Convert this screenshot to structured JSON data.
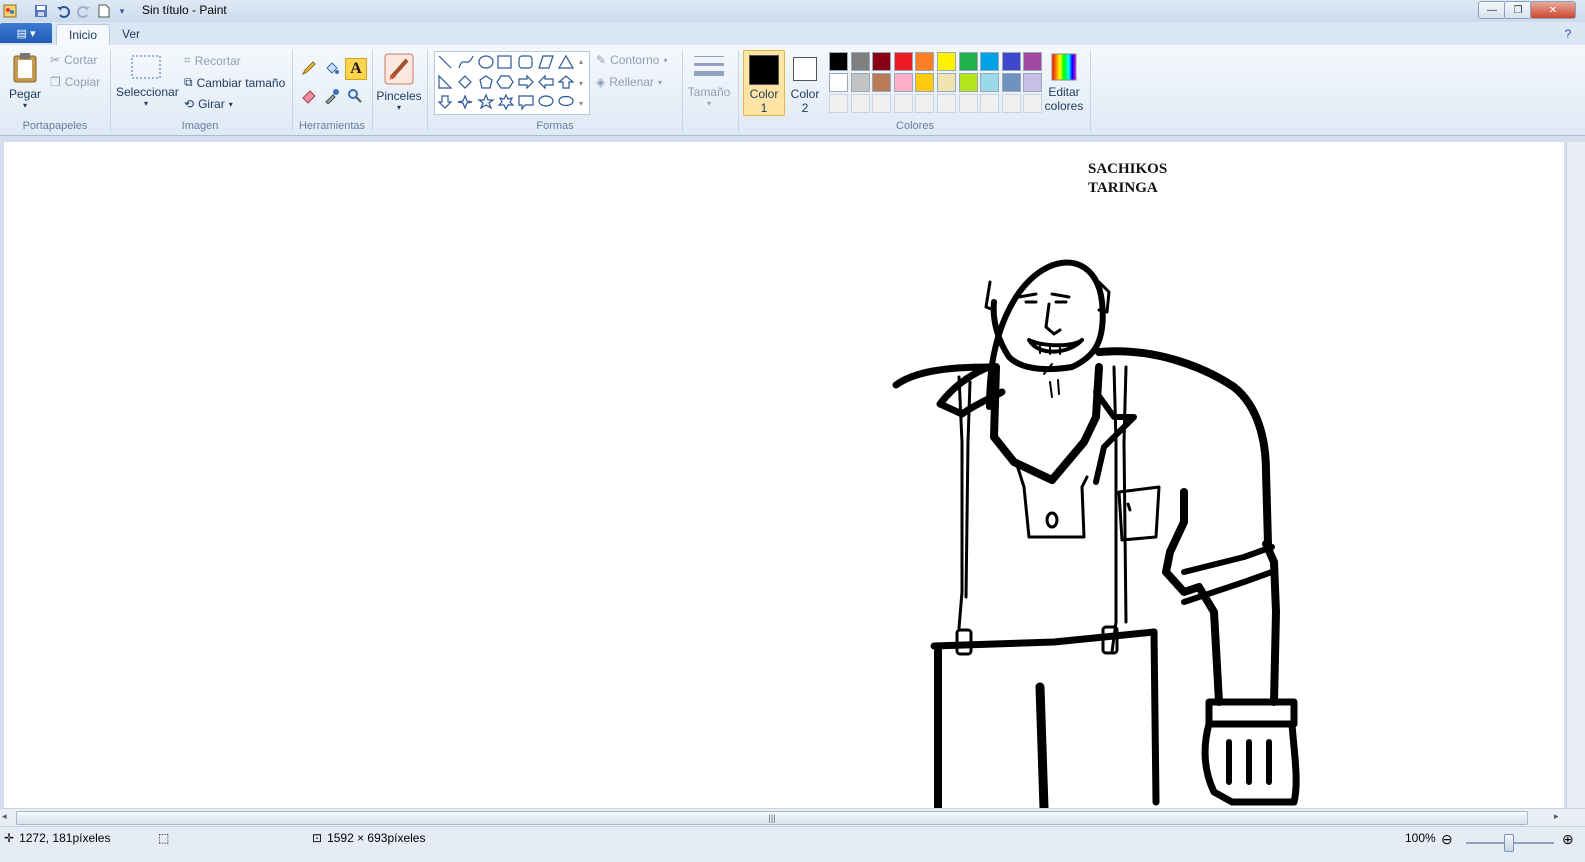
{
  "window": {
    "title": "Sin título - Paint",
    "controls": {
      "minimize": "—",
      "restore": "❐",
      "close": "✕"
    }
  },
  "tabs": [
    {
      "label": "Inicio",
      "active": true
    },
    {
      "label": "Ver",
      "active": false
    }
  ],
  "ribbon": {
    "clipboard": {
      "group": "Portapapeles",
      "paste": "Pegar",
      "cut": "Cortar",
      "copy": "Copiar"
    },
    "image": {
      "group": "Imagen",
      "select": "Seleccionar",
      "crop": "Recortar",
      "resize": "Cambiar tamaño",
      "rotate": "Girar"
    },
    "tools": {
      "group": "Herramientas"
    },
    "brushes": {
      "label": "Pinceles"
    },
    "shapes": {
      "group": "Formas",
      "outline": "Contorno",
      "fill": "Rellenar"
    },
    "size": {
      "label": "Tamaño"
    },
    "colors": {
      "group": "Colores",
      "color1": [
        "Color",
        "1"
      ],
      "color2": [
        "Color",
        "2"
      ],
      "edit": [
        "Editar",
        "colores"
      ],
      "color1_value": "#000000",
      "color2_value": "#ffffff",
      "row1": [
        "#000000",
        "#7f7f7f",
        "#880015",
        "#ed1c24",
        "#ff7f27",
        "#fff200",
        "#22b14c",
        "#00a2e8",
        "#3f48cc",
        "#a349a4"
      ],
      "row2": [
        "#ffffff",
        "#c3c3c3",
        "#b97a57",
        "#ffaec9",
        "#ffc90e",
        "#efe4b0",
        "#b5e61d",
        "#99d9ea",
        "#7092be",
        "#c8bfe7"
      ],
      "row3": [
        "#f0f0f0",
        "#f0f0f0",
        "#f0f0f0",
        "#f0f0f0",
        "#f0f0f0",
        "#f0f0f0",
        "#f0f0f0",
        "#f0f0f0",
        "#f0f0f0",
        "#f0f0f0"
      ]
    }
  },
  "canvas": {
    "caption_line1": "SACHIKOS",
    "caption_line2": "TARINGA"
  },
  "status": {
    "cursor": "1272, 181píxeles",
    "size": "1592 × 693píxeles",
    "zoom": "100%"
  }
}
